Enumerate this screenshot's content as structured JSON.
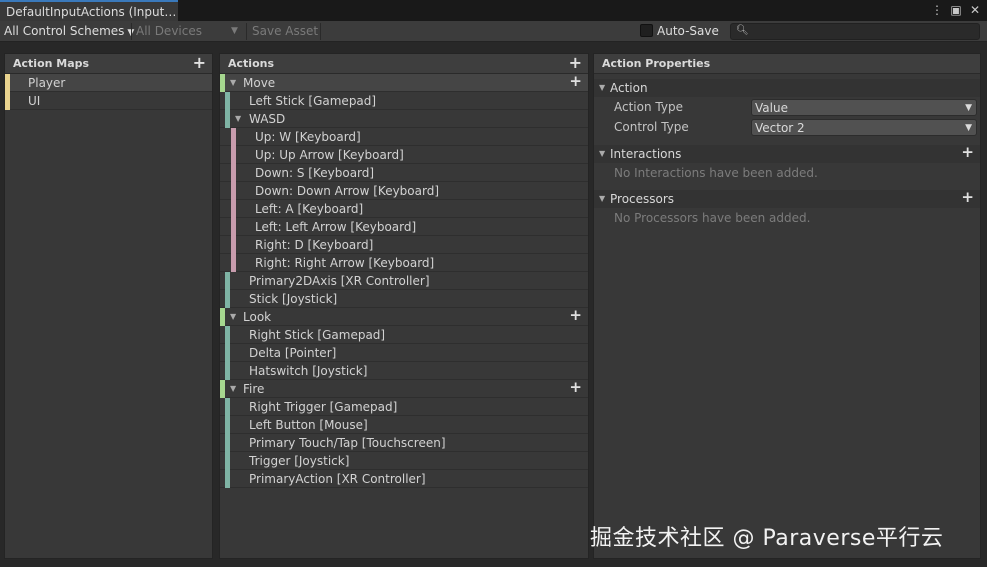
{
  "window": {
    "tab_title": "DefaultInputActions (Input…",
    "icons": [
      "more-vert-icon",
      "maximize-icon",
      "close-icon"
    ]
  },
  "toolbar": {
    "control_schemes": "All Control Schemes",
    "devices": "All Devices",
    "save_asset": "Save Asset",
    "auto_save_label": "Auto-Save",
    "auto_save_checked": false,
    "search_value": ""
  },
  "action_maps": {
    "title": "Action Maps",
    "items": [
      {
        "label": "Player",
        "selected": true
      },
      {
        "label": "UI",
        "selected": false
      }
    ]
  },
  "actions": {
    "title": "Actions",
    "rows": [
      {
        "kind": "action",
        "label": "Move"
      },
      {
        "kind": "binding",
        "label": "Left Stick [Gamepad]"
      },
      {
        "kind": "composite",
        "label": "WASD"
      },
      {
        "kind": "part",
        "label": "Up: W [Keyboard]"
      },
      {
        "kind": "part",
        "label": "Up: Up Arrow [Keyboard]"
      },
      {
        "kind": "part",
        "label": "Down: S [Keyboard]"
      },
      {
        "kind": "part",
        "label": "Down: Down Arrow [Keyboard]"
      },
      {
        "kind": "part",
        "label": "Left: A [Keyboard]"
      },
      {
        "kind": "part",
        "label": "Left: Left Arrow [Keyboard]"
      },
      {
        "kind": "part",
        "label": "Right: D [Keyboard]"
      },
      {
        "kind": "part",
        "label": "Right: Right Arrow [Keyboard]"
      },
      {
        "kind": "binding",
        "label": "Primary2DAxis [XR Controller]"
      },
      {
        "kind": "binding",
        "label": "Stick [Joystick]"
      },
      {
        "kind": "action",
        "label": "Look"
      },
      {
        "kind": "binding",
        "label": "Right Stick [Gamepad]"
      },
      {
        "kind": "binding",
        "label": "Delta [Pointer]"
      },
      {
        "kind": "binding",
        "label": "Hatswitch [Joystick]"
      },
      {
        "kind": "action",
        "label": "Fire"
      },
      {
        "kind": "binding",
        "label": "Right Trigger [Gamepad]"
      },
      {
        "kind": "binding",
        "label": "Left Button [Mouse]"
      },
      {
        "kind": "binding",
        "label": "Primary Touch/Tap [Touchscreen]"
      },
      {
        "kind": "binding",
        "label": "Trigger [Joystick]"
      },
      {
        "kind": "binding",
        "label": "PrimaryAction [XR Controller]"
      }
    ]
  },
  "properties": {
    "title": "Action Properties",
    "action_section": "Action",
    "action_type_label": "Action Type",
    "action_type_value": "Value",
    "control_type_label": "Control Type",
    "control_type_value": "Vector 2",
    "interactions_section": "Interactions",
    "interactions_empty": "No Interactions have been added.",
    "processors_section": "Processors",
    "processors_empty": "No Processors have been added."
  },
  "watermark": "掘金技术社区 @ Paraverse平行云",
  "colors": {
    "action_map_marker": "#ead48f",
    "action_marker": "#a6d78f",
    "binding_marker": "#7fb4a5",
    "composite_part_marker": "#c89cad",
    "tab_accent": "#3a79bb"
  }
}
